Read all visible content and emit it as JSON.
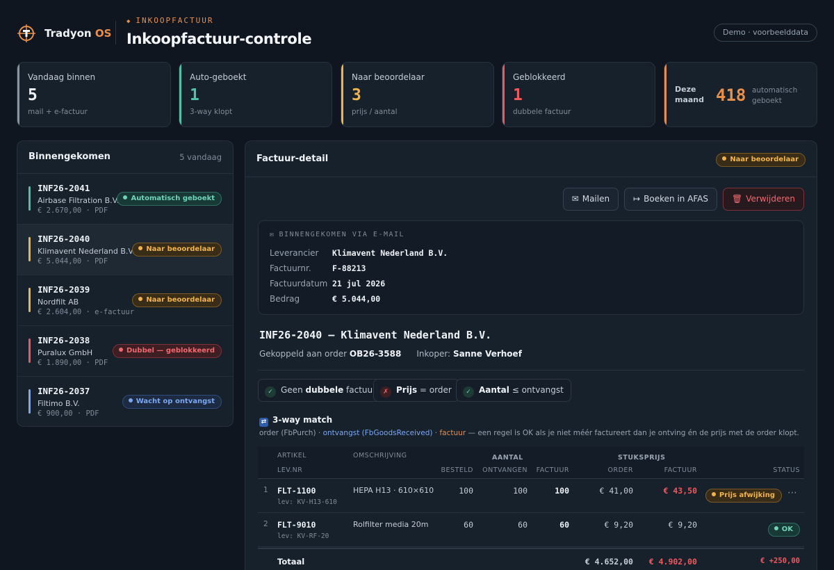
{
  "brand": {
    "name": "Tradyon",
    "suffix": "OS"
  },
  "header": {
    "eyebrow": "INKOOPFACTUUR",
    "title": "Inkoopfactuur-controle",
    "demo": "Demo · voorbeelddata"
  },
  "stats": [
    {
      "label": "Vandaag binnen",
      "value": "5",
      "sub": "mail + e-factuur",
      "color": "#8a96a5"
    },
    {
      "label": "Auto-geboekt",
      "value": "1",
      "sub": "3-way klopt",
      "color": "#4fc3a5"
    },
    {
      "label": "Naar beoordelaar",
      "value": "3",
      "sub": "prijs / aantal",
      "color": "#f0b54a"
    },
    {
      "label": "Geblokkeerd",
      "value": "1",
      "sub": "dubbele factuur",
      "color": "#f0585e"
    }
  ],
  "month": {
    "label": "Deze maand",
    "value": "418",
    "sub": "automatisch geboekt",
    "color": "#e8904a"
  },
  "inbox": {
    "title": "Binnengekomen",
    "count": "5 vandaag",
    "items": [
      {
        "id": "INF26-2041",
        "supplier": "Airbase Filtration B.V.",
        "meta": "€ 2.670,00 · PDF",
        "status": "Automatisch geboekt",
        "tone": "green",
        "accent": "#4fc3a5"
      },
      {
        "id": "INF26-2040",
        "supplier": "Klimavent Nederland B.V.",
        "meta": "€ 5.044,00 · PDF",
        "status": "Naar beoordelaar",
        "tone": "amber",
        "accent": "#f0b54a"
      },
      {
        "id": "INF26-2039",
        "supplier": "Nordfilt AB",
        "meta": "€ 2.604,00 · e-factuur",
        "status": "Naar beoordelaar",
        "tone": "amber",
        "accent": "#f0b54a"
      },
      {
        "id": "INF26-2038",
        "supplier": "Puralux GmbH",
        "meta": "€ 1.890,00 · PDF",
        "status": "Dubbel — geblokkeerd",
        "tone": "red",
        "accent": "#f0585e"
      },
      {
        "id": "INF26-2037",
        "supplier": "Filtimo B.V.",
        "meta": "€ 900,00 · PDF",
        "status": "Wacht op ontvangst",
        "tone": "blue",
        "accent": "#7ba7f0"
      }
    ]
  },
  "detail": {
    "title": "Factuur-detail",
    "status": "Naar beoordelaar",
    "actions": {
      "mail": "Mailen",
      "book": "Boeken in AFAS",
      "delete": "Verwijderen"
    },
    "mail": {
      "heading": "BINNENGEKOMEN VIA E-MAIL",
      "fields": [
        {
          "k": "Leverancier",
          "v": "Klimavent Nederland B.V."
        },
        {
          "k": "Factuurnr.",
          "v": "F-88213"
        },
        {
          "k": "Factuurdatum",
          "v": "21 jul 2026"
        },
        {
          "k": "Bedrag",
          "v": "€ 5.044,00"
        }
      ]
    },
    "invoice_title": "INF26-2040 — Klimavent Nederland B.V.",
    "linked_label": "Gekoppeld aan order",
    "order": "OB26-3588",
    "buyer_label": "Inkoper:",
    "buyer": "Sanne Verhoef",
    "checks": [
      {
        "pre": "Geen",
        "bold": "dubbele",
        "post": "factuur",
        "ok": true
      },
      {
        "pre": "",
        "bold": "Prijs",
        "post": "= order",
        "ok": false
      },
      {
        "pre": "",
        "bold": "Aantal",
        "post": "≤ ontvangst",
        "ok": true
      }
    ],
    "match": {
      "title": "3-way match",
      "d1": "order (FbPurch)",
      "d2": "ontvangst (FbGoodsReceived)",
      "d3": "factuur",
      "d4": "— een regel is OK als je niet méér factureert dan je ontving én de prijs met de order klopt."
    },
    "table": {
      "h_artikel": "ARTIKEL",
      "h_levnr": "LEV.NR",
      "h_omschrijving": "OMSCHRIJVING",
      "h_aantal": "AANTAL",
      "h_stuksprijs": "STUKSPRIJS",
      "h_besteld": "BESTELD",
      "h_ontvangen": "ONTVANGEN",
      "h_factuur": "FACTUUR",
      "h_order": "ORDER",
      "h_factuur2": "FACTUUR",
      "h_status": "STATUS",
      "rows": [
        {
          "n": "1",
          "code": "FLT-1100",
          "lev": "lev: KV-H13-610",
          "desc": "HEPA H13 · 610×610",
          "besteld": "100",
          "ontvangen": "100",
          "factuur": "100",
          "order_price": "€ 41,00",
          "invoice_price": "€ 43,50",
          "status": "Prijs afwijking",
          "tone": "amber",
          "more": "⋯"
        },
        {
          "n": "2",
          "code": "FLT-9010",
          "lev": "lev: KV-RF-20",
          "desc": "Rolfilter media 20m",
          "besteld": "60",
          "ontvangen": "60",
          "factuur": "60",
          "order_price": "€ 9,20",
          "invoice_price": "€ 9,20",
          "status": "OK",
          "tone": "green",
          "more": ""
        }
      ],
      "total_label": "Totaal",
      "total_order": "€ 4.652,00",
      "total_invoice": "€ 4.902,00",
      "total_diff": "€ +250,00"
    }
  }
}
